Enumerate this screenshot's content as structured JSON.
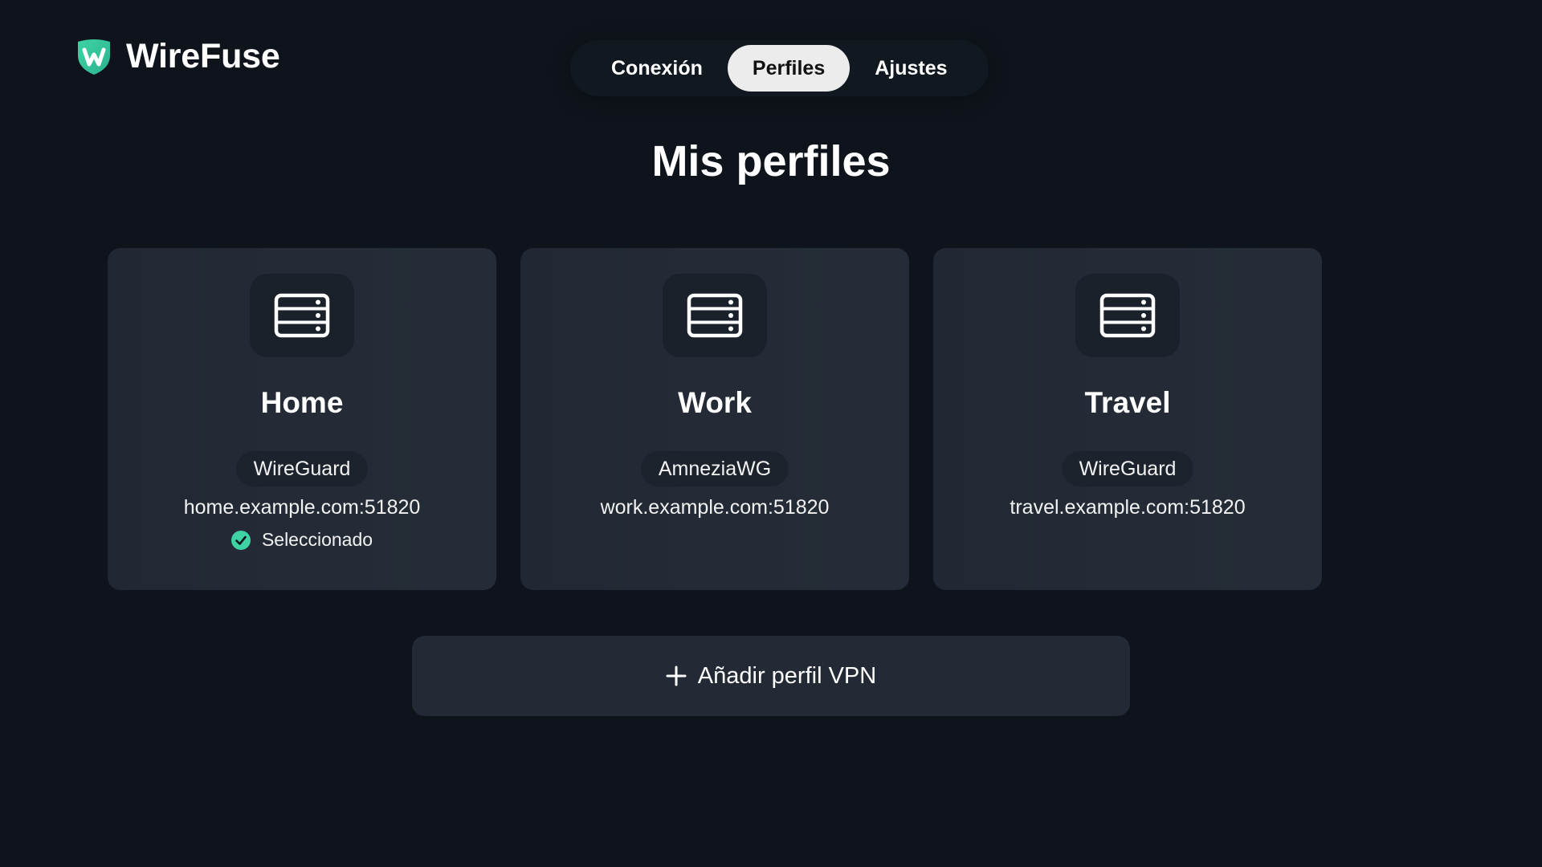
{
  "app": {
    "name": "WireFuse",
    "logo_icon": "shield-w-logo-icon",
    "accent_color": "#3fd3a4"
  },
  "nav": {
    "tabs": [
      {
        "label": "Conexión",
        "active": false
      },
      {
        "label": "Perfiles",
        "active": true
      },
      {
        "label": "Ajustes",
        "active": false
      }
    ]
  },
  "page": {
    "title": "Mis perfiles"
  },
  "profiles": [
    {
      "name": "Home",
      "icon": "server-icon",
      "protocol": "WireGuard",
      "endpoint": "home.example.com:51820",
      "selected": true,
      "selected_label": "Seleccionado"
    },
    {
      "name": "Work",
      "icon": "server-icon",
      "protocol": "AmneziaWG",
      "endpoint": "work.example.com:51820",
      "selected": false
    },
    {
      "name": "Travel",
      "icon": "server-icon",
      "protocol": "WireGuard",
      "endpoint": "travel.example.com:51820",
      "selected": false
    }
  ],
  "add_profile": {
    "label": "Añadir perfil VPN",
    "icon": "plus-icon"
  },
  "colors": {
    "background": "#0f141c",
    "card": "#232a35",
    "selected_check": "#3fd3a4"
  }
}
